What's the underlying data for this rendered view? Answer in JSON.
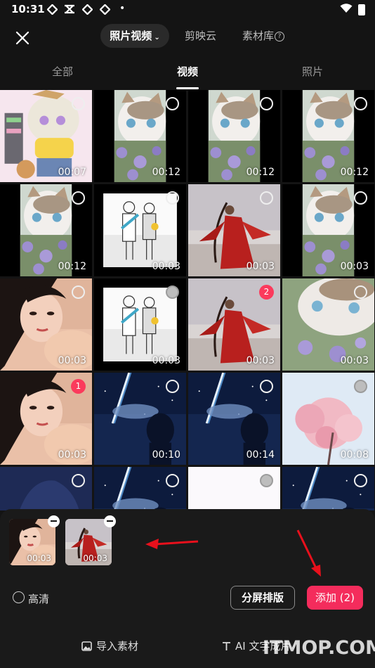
{
  "status_bar": {
    "time": "10:31",
    "dot": "•"
  },
  "top_bar": {
    "segments": [
      {
        "label": "照片视频",
        "active": true
      },
      {
        "label": "剪映云",
        "active": false
      },
      {
        "label": "素材库",
        "active": false
      }
    ],
    "help_glyph": "?"
  },
  "tabs": [
    {
      "label": "全部",
      "active": false
    },
    {
      "label": "视频",
      "active": true
    },
    {
      "label": "照片",
      "active": false
    }
  ],
  "grid": {
    "items": [
      {
        "type": "anime-girl-pink",
        "duration": "00:07",
        "selection": ""
      },
      {
        "type": "cat-flowers",
        "duration": "00:12",
        "selection": ""
      },
      {
        "type": "cat-flowers",
        "duration": "00:12",
        "selection": ""
      },
      {
        "type": "cat-flowers",
        "duration": "00:12",
        "selection": ""
      },
      {
        "type": "cat-flowers",
        "duration": "00:12",
        "selection": ""
      },
      {
        "type": "sketch-couple",
        "duration": "00:03",
        "selection": ""
      },
      {
        "type": "red-dress-girl",
        "duration": "00:03",
        "selection": ""
      },
      {
        "type": "cat-flowers",
        "duration": "00:03",
        "selection": ""
      },
      {
        "type": "portrait-girl",
        "duration": "00:03",
        "selection": ""
      },
      {
        "type": "sketch-couple",
        "duration": "00:03",
        "selection": ""
      },
      {
        "type": "red-dress-girl",
        "duration": "00:03",
        "selection": "2"
      },
      {
        "type": "cat-closeup",
        "duration": "00:03",
        "selection": ""
      },
      {
        "type": "portrait-girl",
        "duration": "00:03",
        "selection": "1"
      },
      {
        "type": "night-sky-comet",
        "duration": "00:10",
        "selection": ""
      },
      {
        "type": "night-sky-comet",
        "duration": "00:14",
        "selection": ""
      },
      {
        "type": "cherry-blossom",
        "duration": "00:08",
        "selection": ""
      },
      {
        "type": "anime-boy-night",
        "duration": "",
        "selection": ""
      },
      {
        "type": "night-sky-comet",
        "duration": "",
        "selection": ""
      },
      {
        "type": "blank-white",
        "duration": "",
        "selection": ""
      },
      {
        "type": "night-sky-comet",
        "duration": "",
        "selection": ""
      }
    ]
  },
  "selected_tray": {
    "items": [
      {
        "type": "portrait-girl",
        "duration": "00:03"
      },
      {
        "type": "red-dress-girl",
        "duration": "00:03"
      }
    ]
  },
  "options": {
    "hd_label": "高清"
  },
  "buttons": {
    "split_layout": "分屏排版",
    "add": "添加 (2)"
  },
  "bottom_bar": {
    "import": "导入素材",
    "ai_text": "AI 文字成片"
  },
  "watermark": "ITMOP.COM",
  "colors": {
    "accent": "#f42c5c",
    "badge": "#fb3a5c",
    "background": "#141414",
    "annotation_arrow": "#e8101c"
  }
}
